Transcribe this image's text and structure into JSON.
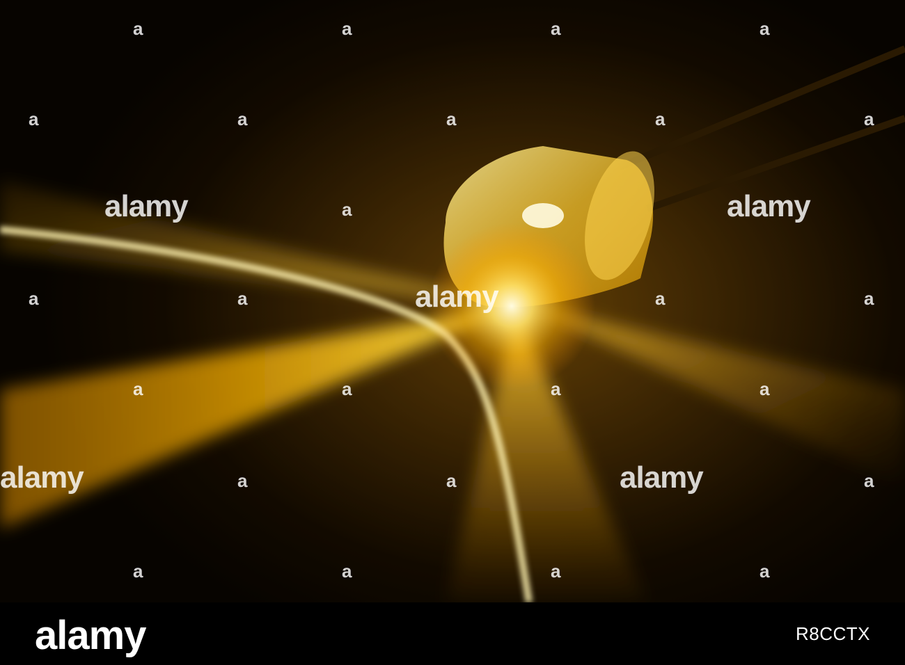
{
  "watermark": {
    "text": "alamy",
    "mark": "a"
  },
  "footer": {
    "logo": "alamy",
    "image_id": "R8CCTX"
  },
  "colors": {
    "glow": "#ffc21a",
    "beam": "#ffb000",
    "background": "#120a00",
    "footer": "#000000"
  }
}
